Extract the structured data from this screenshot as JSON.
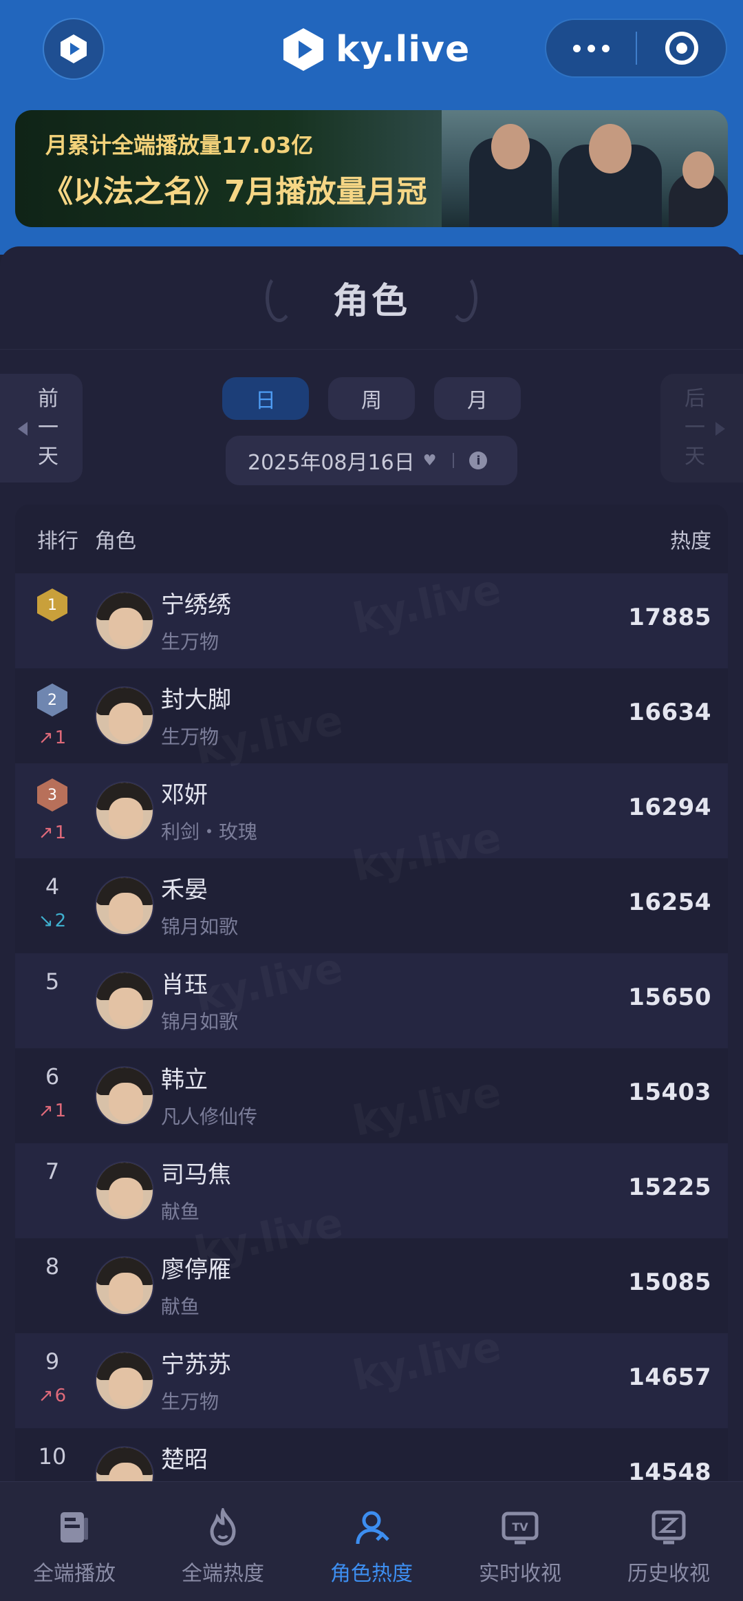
{
  "header": {
    "brand": "ky.live",
    "banner_line1": "月累计全端播放量17.03亿",
    "banner_line2": "《以法之名》7月播放量月冠"
  },
  "panel": {
    "title": "角色",
    "prev_label": "前一天",
    "next_label": "后一天",
    "segments": [
      "日",
      "周",
      "月"
    ],
    "selected_segment": "日",
    "date": "2025年08月16日"
  },
  "table": {
    "headers": {
      "rank": "排行",
      "role": "角色",
      "heat": "热度"
    },
    "rows": [
      {
        "rank": "1",
        "medal": "gold",
        "trend": "",
        "trend_dir": "",
        "name": "宁绣绣",
        "drama": "生万物",
        "heat": "17885"
      },
      {
        "rank": "2",
        "medal": "silver",
        "trend": "1",
        "trend_dir": "up",
        "name": "封大脚",
        "drama": "生万物",
        "heat": "16634"
      },
      {
        "rank": "3",
        "medal": "bronze",
        "trend": "1",
        "trend_dir": "up",
        "name": "邓妍",
        "drama": "利剑・玫瑰",
        "heat": "16294"
      },
      {
        "rank": "4",
        "medal": "",
        "trend": "2",
        "trend_dir": "down",
        "name": "禾晏",
        "drama": "锦月如歌",
        "heat": "16254"
      },
      {
        "rank": "5",
        "medal": "",
        "trend": "",
        "trend_dir": "",
        "name": "肖珏",
        "drama": "锦月如歌",
        "heat": "15650"
      },
      {
        "rank": "6",
        "medal": "",
        "trend": "1",
        "trend_dir": "up",
        "name": "韩立",
        "drama": "凡人修仙传",
        "heat": "15403"
      },
      {
        "rank": "7",
        "medal": "",
        "trend": "",
        "trend_dir": "",
        "name": "司马焦",
        "drama": "献鱼",
        "heat": "15225"
      },
      {
        "rank": "8",
        "medal": "",
        "trend": "",
        "trend_dir": "",
        "name": "廖停雁",
        "drama": "献鱼",
        "heat": "15085"
      },
      {
        "rank": "9",
        "medal": "",
        "trend": "6",
        "trend_dir": "up",
        "name": "宁苏苏",
        "drama": "生万物",
        "heat": "14657"
      },
      {
        "rank": "10",
        "medal": "",
        "trend": "",
        "trend_dir": "",
        "name": "楚昭",
        "drama": "",
        "heat": "14548"
      }
    ]
  },
  "watermark": "ky.live",
  "tabbar": {
    "items": [
      {
        "label": "全端播放",
        "icon": "playbook-icon",
        "active": false
      },
      {
        "label": "全端热度",
        "icon": "flame-icon",
        "active": false
      },
      {
        "label": "角色热度",
        "icon": "person-icon",
        "active": true
      },
      {
        "label": "实时收视",
        "icon": "tv-icon",
        "active": false
      },
      {
        "label": "历史收视",
        "icon": "history-icon",
        "active": false
      }
    ]
  },
  "colors": {
    "header_blue": "#2266bd",
    "accent": "#3d8ef0",
    "gold": "#c9a03b",
    "silver": "#6f86b0",
    "bronze": "#b8705a",
    "trend_up": "#e06a7a",
    "trend_down": "#3fb0cf"
  }
}
